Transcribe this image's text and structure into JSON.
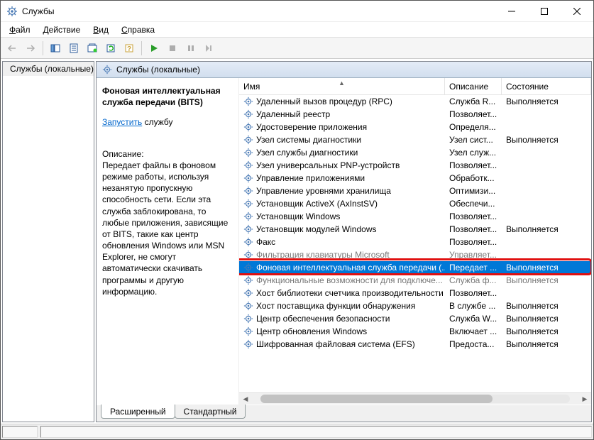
{
  "title": "Службы",
  "menus": [
    "Файл",
    "Действие",
    "Вид",
    "Справка"
  ],
  "tree_label": "Службы (локальные)",
  "right_header": "Службы (локальные)",
  "detail": {
    "title": "Фоновая интеллектуальная служба передачи (BITS)",
    "start_link": "Запустить",
    "start_suffix": " службу",
    "desc_label": "Описание:",
    "desc_text": "Передает файлы в фоновом режиме работы, используя незанятую пропускную способность сети. Если эта служба заблокирована, то любые приложения, зависящие от BITS, такие как центр обновления Windows или MSN Explorer, не смогут автоматически скачивать программы и другую информацию."
  },
  "columns": {
    "name": "Имя",
    "desc": "Описание",
    "state": "Состояние"
  },
  "rows": [
    {
      "name": "Удаленный вызов процедур (RPC)",
      "desc": "Служба R...",
      "state": "Выполняется"
    },
    {
      "name": "Удаленный реестр",
      "desc": "Позволяет...",
      "state": ""
    },
    {
      "name": "Удостоверение приложения",
      "desc": "Определя...",
      "state": ""
    },
    {
      "name": "Узел системы диагностики",
      "desc": "Узел сист...",
      "state": "Выполняется"
    },
    {
      "name": "Узел службы диагностики",
      "desc": "Узел служ...",
      "state": ""
    },
    {
      "name": "Узел универсальных PNP-устройств",
      "desc": "Позволяет...",
      "state": ""
    },
    {
      "name": "Управление приложениями",
      "desc": "Обработк...",
      "state": ""
    },
    {
      "name": "Управление уровнями хранилища",
      "desc": "Оптимизи...",
      "state": ""
    },
    {
      "name": "Установщик ActiveX (AxInstSV)",
      "desc": "Обеспечи...",
      "state": ""
    },
    {
      "name": "Установщик Windows",
      "desc": "Позволяет...",
      "state": ""
    },
    {
      "name": "Установщик модулей Windows",
      "desc": "Позволяет...",
      "state": "Выполняется"
    },
    {
      "name": "Факс",
      "desc": "Позволяет...",
      "state": ""
    },
    {
      "name": "Фильтрация клавиатуры Microsoft",
      "desc": "Управляет...",
      "state": "",
      "grayed": true
    },
    {
      "name": "Фоновая интеллектуальная служба передачи (...",
      "desc": "Передает ...",
      "state": "Выполняется",
      "selected": true
    },
    {
      "name": "Функциональные возможности для подключе...",
      "desc": "Служба ф...",
      "state": "Выполняется",
      "grayed": true
    },
    {
      "name": "Хост библиотеки счетчика производительности",
      "desc": "Позволяет...",
      "state": ""
    },
    {
      "name": "Хост поставщика функции обнаружения",
      "desc": "В службе ...",
      "state": "Выполняется"
    },
    {
      "name": "Центр обеспечения безопасности",
      "desc": "Служба W...",
      "state": "Выполняется"
    },
    {
      "name": "Центр обновления Windows",
      "desc": "Включает ...",
      "state": "Выполняется"
    },
    {
      "name": "Шифрованная файловая система (EFS)",
      "desc": "Предоста...",
      "state": "Выполняется"
    }
  ],
  "selected_index": 13,
  "tabs": {
    "extended": "Расширенный",
    "standard": "Стандартный"
  }
}
